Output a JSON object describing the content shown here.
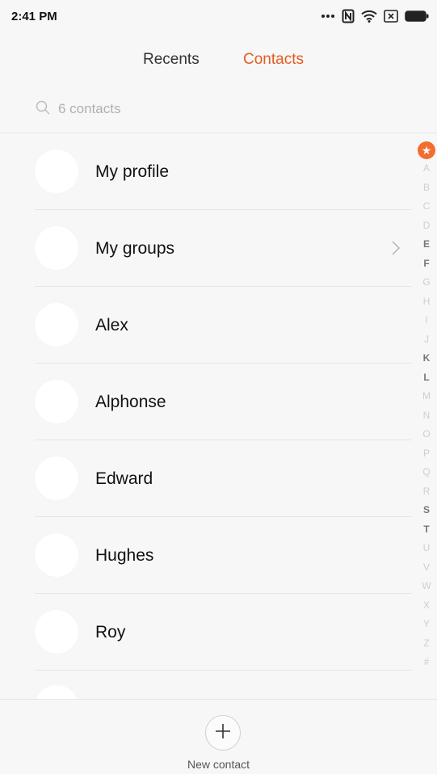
{
  "status_bar": {
    "time": "2:41 PM",
    "icons": [
      "more-dots-icon",
      "nfc-icon",
      "wifi-icon",
      "sim-icon",
      "battery-icon"
    ]
  },
  "tabs": [
    {
      "label": "Recents",
      "active": false
    },
    {
      "label": "Contacts",
      "active": true
    }
  ],
  "search": {
    "placeholder": "6 contacts"
  },
  "contacts": [
    {
      "name": "My profile"
    },
    {
      "name": "My groups",
      "has_chevron": true
    },
    {
      "name": "Alex"
    },
    {
      "name": "Alphonse"
    },
    {
      "name": "Edward"
    },
    {
      "name": "Hughes"
    },
    {
      "name": "Roy"
    }
  ],
  "alphabet_index": {
    "star": "★",
    "letters": [
      "A",
      "B",
      "C",
      "D",
      "E",
      "F",
      "G",
      "H",
      "I",
      "J",
      "K",
      "L",
      "M",
      "N",
      "O",
      "P",
      "Q",
      "R",
      "S",
      "T",
      "U",
      "V",
      "W",
      "X",
      "Y",
      "Z",
      "#"
    ],
    "active_letters": [
      "E",
      "F",
      "K",
      "L",
      "S",
      "T"
    ]
  },
  "bottom": {
    "new_contact_label": "New contact"
  },
  "colors": {
    "accent": "#e65a1e",
    "star_badge": "#f26d2f"
  }
}
